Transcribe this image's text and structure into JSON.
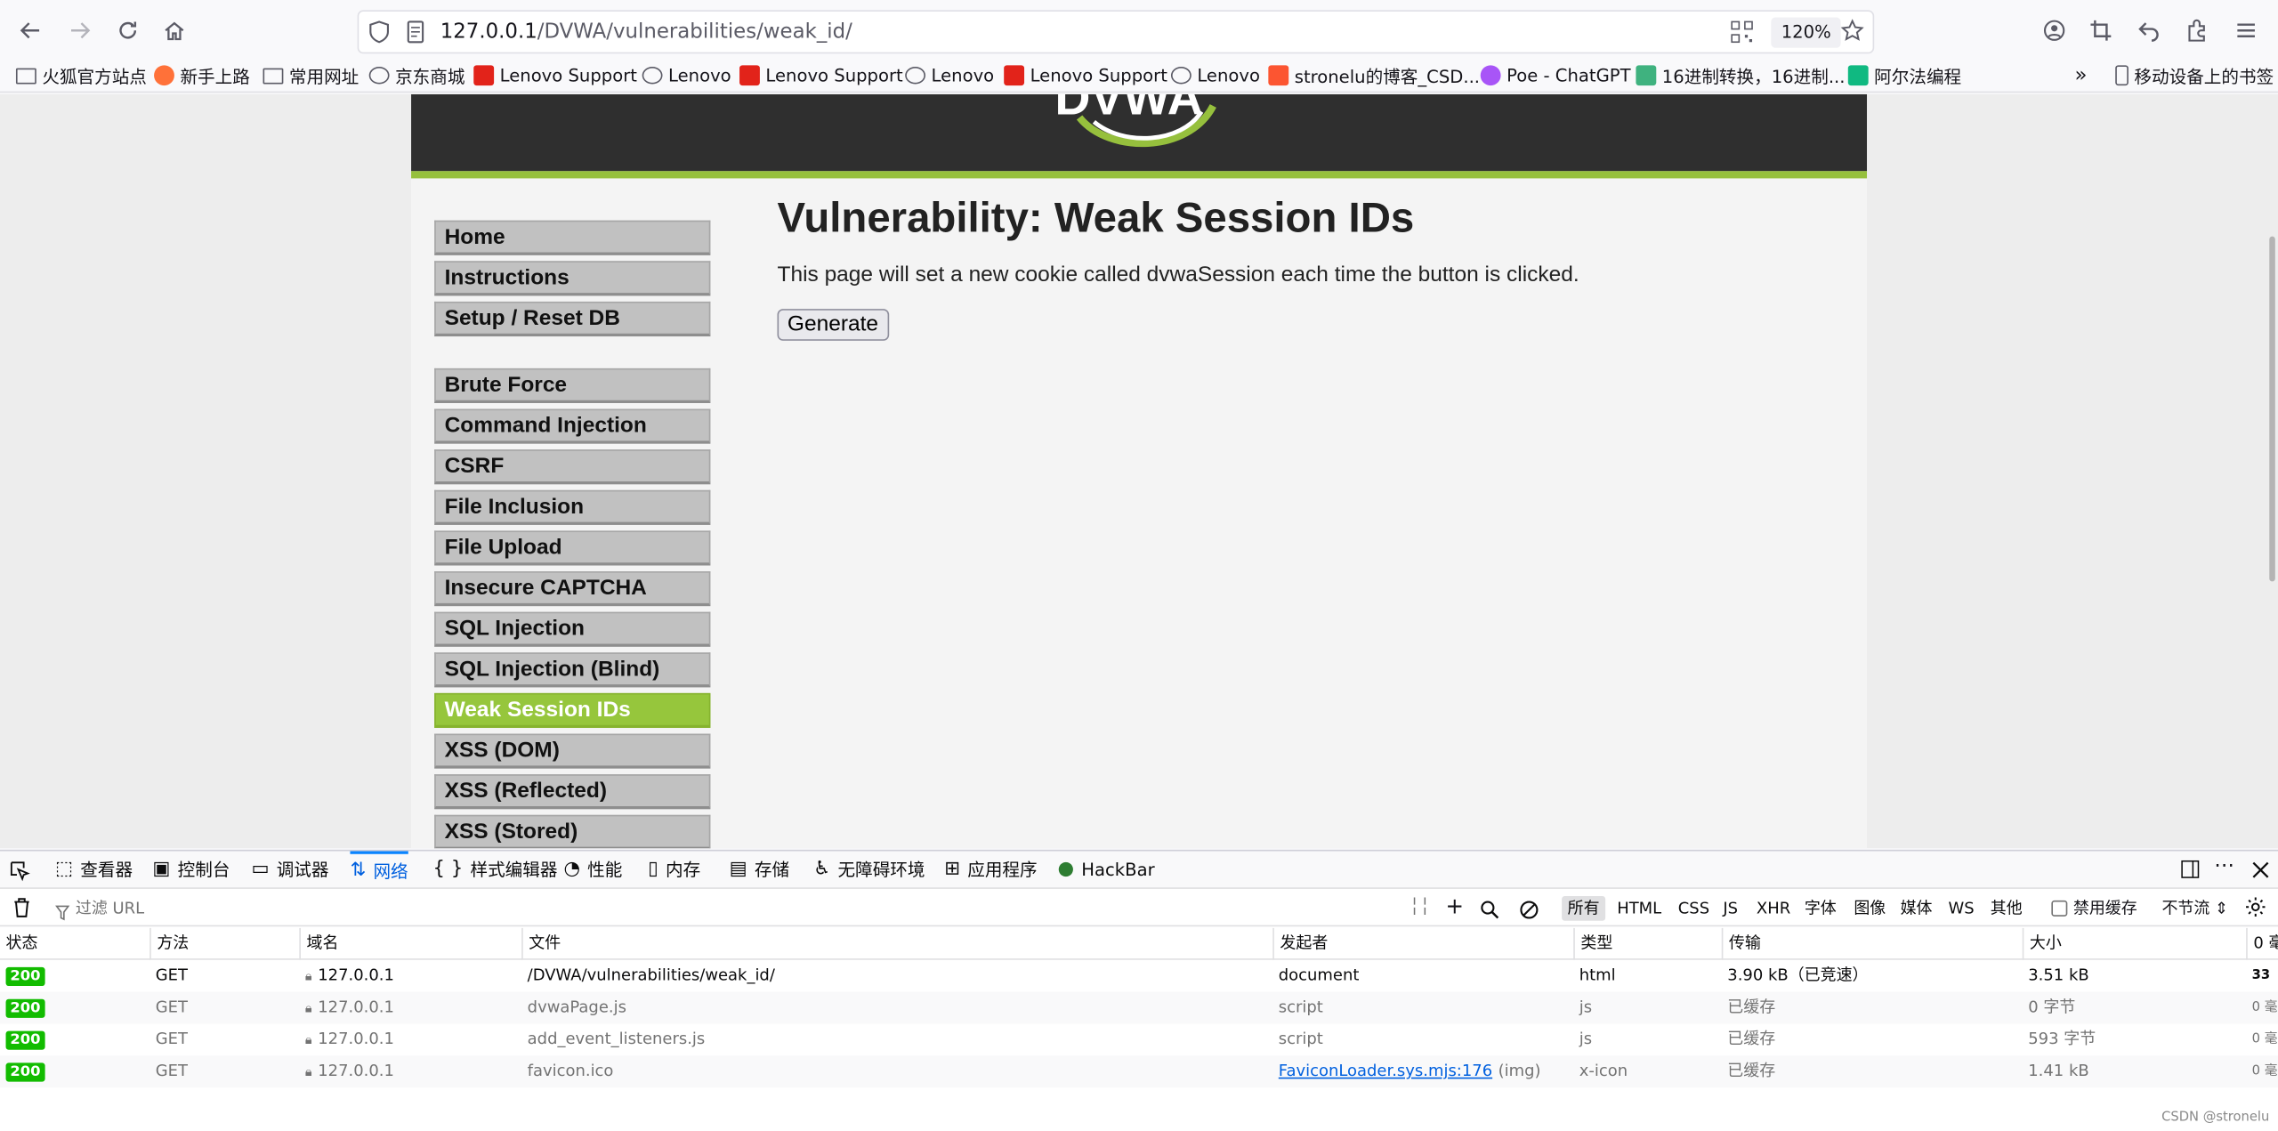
{
  "browser": {
    "url_host": "127.0.0.1",
    "url_path": "/DVWA/vulnerabilities/weak_id/",
    "zoom": "120%"
  },
  "bookmarks": [
    {
      "label": "火狐官方站点",
      "icon": "folder-icon"
    },
    {
      "label": "新手上路",
      "icon": "firefox-icon"
    },
    {
      "label": "常用网址",
      "icon": "folder-icon"
    },
    {
      "label": "京东商城",
      "icon": "globe-icon"
    },
    {
      "label": "Lenovo Support",
      "icon": "lenovo-icon"
    },
    {
      "label": "Lenovo",
      "icon": "globe-icon"
    },
    {
      "label": "Lenovo Support",
      "icon": "lenovo-icon"
    },
    {
      "label": "Lenovo",
      "icon": "globe-icon"
    },
    {
      "label": "Lenovo Support",
      "icon": "lenovo-icon"
    },
    {
      "label": "Lenovo",
      "icon": "globe-icon"
    },
    {
      "label": "stronelu的博客_CSD...",
      "icon": "csdn-icon"
    },
    {
      "label": "Poe - ChatGPT",
      "icon": "poe-icon"
    },
    {
      "label": "16进制转换，16进制...",
      "icon": "gear-icon"
    },
    {
      "label": "阿尔法编程",
      "icon": "alpha-icon"
    }
  ],
  "bookmarks_other": "移动设备上的书签",
  "dvwa": {
    "logo_text": "DVWA",
    "menu_top": [
      "Home",
      "Instructions",
      "Setup / Reset DB"
    ],
    "menu_vulns": [
      "Brute Force",
      "Command Injection",
      "CSRF",
      "File Inclusion",
      "File Upload",
      "Insecure CAPTCHA",
      "SQL Injection",
      "SQL Injection (Blind)",
      "Weak Session IDs",
      "XSS (DOM)",
      "XSS (Reflected)",
      "XSS (Stored)"
    ],
    "active_item": "Weak Session IDs",
    "title": "Vulnerability: Weak Session IDs",
    "description": "This page will set a new cookie called dvwaSession each time the button is clicked.",
    "button_label": "Generate"
  },
  "devtools": {
    "tabs": [
      {
        "label": "查看器",
        "icon": "inspector-icon"
      },
      {
        "label": "控制台",
        "icon": "console-icon"
      },
      {
        "label": "调试器",
        "icon": "debugger-icon"
      },
      {
        "label": "网络",
        "icon": "network-icon",
        "active": true
      },
      {
        "label": "样式编辑器",
        "icon": "style-editor-icon"
      },
      {
        "label": "性能",
        "icon": "performance-icon"
      },
      {
        "label": "内存",
        "icon": "memory-icon"
      },
      {
        "label": "存储",
        "icon": "storage-icon"
      },
      {
        "label": "无障碍环境",
        "icon": "accessibility-icon"
      },
      {
        "label": "应用程序",
        "icon": "application-icon"
      },
      {
        "label": "HackBar",
        "icon": "hackbar-icon"
      }
    ],
    "filter_placeholder": "过滤 URL",
    "type_filters": [
      "所有",
      "HTML",
      "CSS",
      "JS",
      "XHR",
      "字体",
      "图像",
      "媒体",
      "WS",
      "其他"
    ],
    "disable_cache": "禁用缓存",
    "throttle": "不节流 ⇕",
    "columns": [
      "状态",
      "方法",
      "域名",
      "文件",
      "发起者",
      "类型",
      "传输",
      "大小",
      "0 毫"
    ],
    "rows": [
      {
        "status": "200",
        "method": "GET",
        "domain": "127.0.0.1",
        "file": "/DVWA/vulnerabilities/weak_id/",
        "initiator": "document",
        "initiator_extra": "",
        "type": "html",
        "transfer": "3.90 kB（已竞速）",
        "size": "3.51 kB",
        "timing": "33",
        "cached": false
      },
      {
        "status": "200",
        "method": "GET",
        "domain": "127.0.0.1",
        "file": "dvwaPage.js",
        "initiator": "script",
        "initiator_extra": "",
        "type": "js",
        "transfer": "已缓存",
        "size": "0 字节",
        "timing": "0 毫",
        "cached": true
      },
      {
        "status": "200",
        "method": "GET",
        "domain": "127.0.0.1",
        "file": "add_event_listeners.js",
        "initiator": "script",
        "initiator_extra": "",
        "type": "js",
        "transfer": "已缓存",
        "size": "593 字节",
        "timing": "0 毫",
        "cached": true
      },
      {
        "status": "200",
        "method": "GET",
        "domain": "127.0.0.1",
        "file": "favicon.ico",
        "initiator": "FaviconLoader.sys.mjs:176",
        "initiator_extra": "(img)",
        "type": "x-icon",
        "transfer": "已缓存",
        "size": "1.41 kB",
        "timing": "0 毫",
        "cached": true
      }
    ]
  },
  "watermark": "CSDN @stronelu"
}
